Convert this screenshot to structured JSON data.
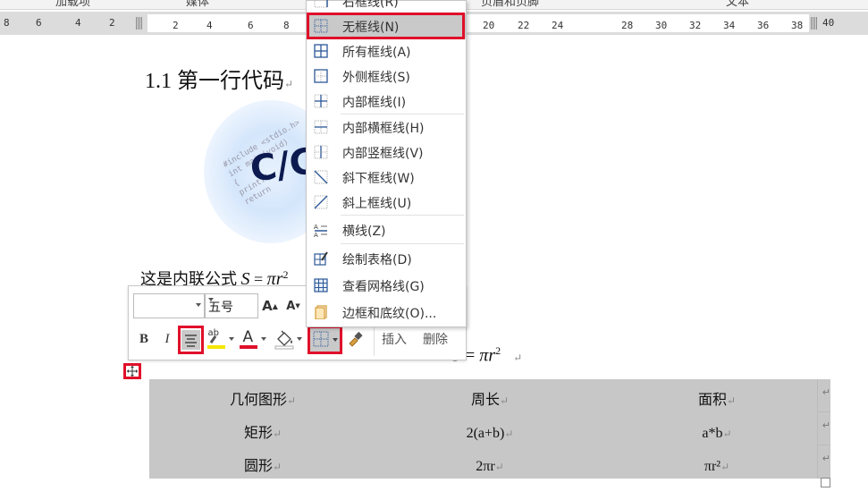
{
  "ribbon_groups": [
    "加载项",
    "媒体",
    "页眉和页脚",
    "文本"
  ],
  "ruler": {
    "ticks": [
      "8",
      "6",
      "4",
      "2",
      "2",
      "4",
      "6",
      "8",
      "20",
      "22",
      "24",
      "28",
      "30",
      "32",
      "34",
      "36",
      "38",
      "40"
    ]
  },
  "document": {
    "heading": "1.1 第一行代码",
    "logo": {
      "big_text": "C/C",
      "code_lines": [
        "#include <stdio.h>",
        "int main(void)",
        "{",
        "printf(",
        "return"
      ]
    },
    "inline_formula_prefix": "这是内联公式",
    "formula_S": "S",
    "formula_eq": " = ",
    "formula_pi": "π",
    "formula_r": "r",
    "formula_exp": "2",
    "table": {
      "rows": [
        [
          "几何图形",
          "周长",
          "面积"
        ],
        [
          "矩形",
          "2(a+b)",
          "a*b"
        ],
        [
          "圆形",
          "2πr",
          "πr²"
        ]
      ]
    }
  },
  "mini_toolbar": {
    "font_name": "",
    "font_size": "五号",
    "grow_font": "A",
    "shrink_font": "A",
    "bold": "B",
    "italic": "I",
    "highlight_label": "ab",
    "font_color_label": "A",
    "insert_label": "插入",
    "delete_label": "删除"
  },
  "border_menu": {
    "items": [
      {
        "label": "右框线(R)",
        "icon": "right-border-icon"
      },
      {
        "label": "无框线(N)",
        "icon": "no-border-icon",
        "selected": true
      },
      {
        "label": "所有框线(A)",
        "icon": "all-borders-icon"
      },
      {
        "label": "外侧框线(S)",
        "icon": "outside-borders-icon"
      },
      {
        "label": "内部框线(I)",
        "icon": "inside-borders-icon"
      },
      {
        "label": "内部横框线(H)",
        "icon": "inside-horizontal-border-icon"
      },
      {
        "label": "内部竖框线(V)",
        "icon": "inside-vertical-border-icon"
      },
      {
        "label": "斜下框线(W)",
        "icon": "diagonal-down-border-icon"
      },
      {
        "label": "斜上框线(U)",
        "icon": "diagonal-up-border-icon"
      },
      {
        "label": "横线(Z)",
        "icon": "horizontal-line-icon"
      },
      {
        "label": "绘制表格(D)",
        "icon": "draw-table-icon"
      },
      {
        "label": "查看网格线(G)",
        "icon": "view-gridlines-icon"
      },
      {
        "label": "边框和底纹(O)...",
        "icon": "borders-shading-icon"
      }
    ]
  },
  "colors": {
    "highlight_red": "#e0102a",
    "table_shading": "#c7c7c7",
    "menu_selected": "#c9c9c9",
    "text_highlight_yellow": "#f5e600",
    "font_color_red": "#e0102a",
    "icon_blue": "#2b5797"
  }
}
